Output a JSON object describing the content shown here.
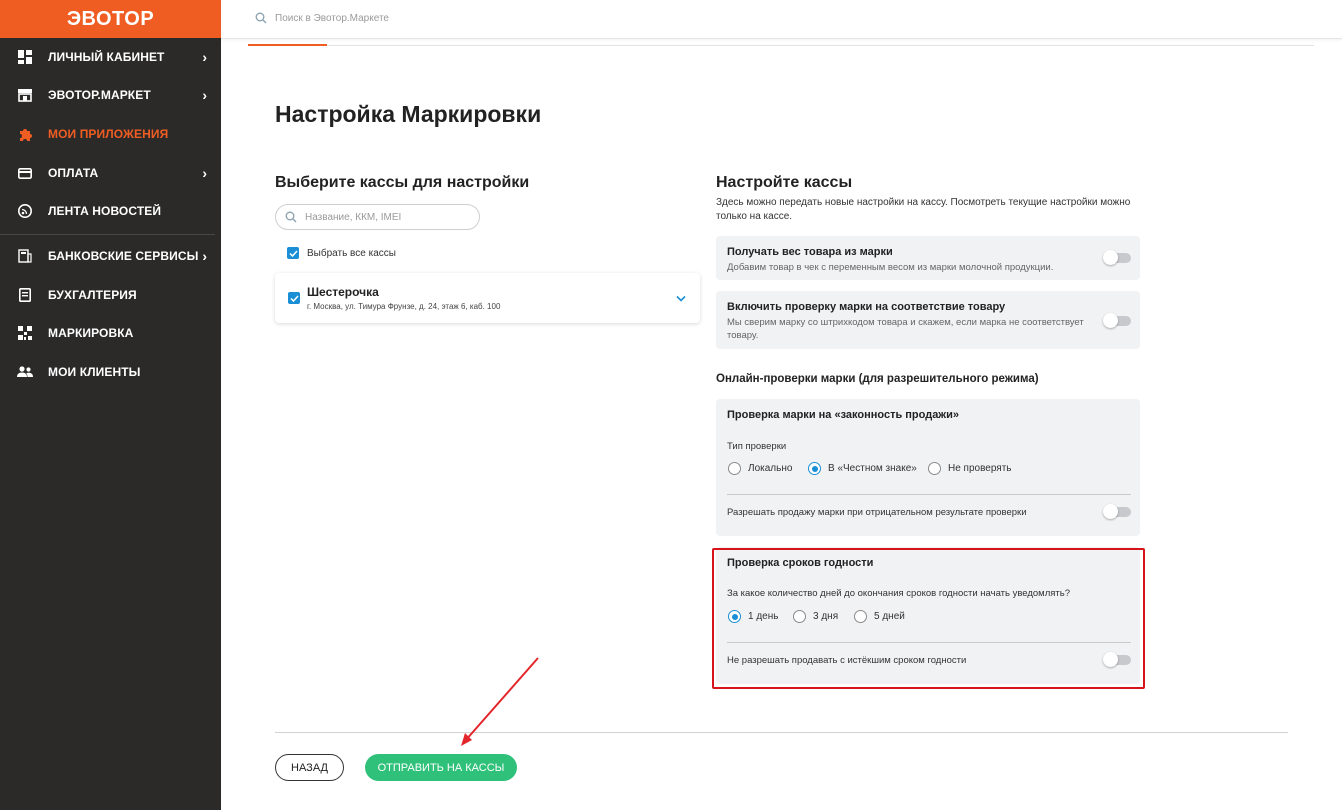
{
  "brand": {
    "logo": "ЭВОТОР",
    "accent": "#f05d22",
    "sidebar_bg": "#2b2a29",
    "link_blue": "#1a8fd6",
    "button_green": "#2fc17a",
    "highlight_red": "#d6141a"
  },
  "topbar": {
    "search_placeholder": "Поиск в Эвотор.Маркете"
  },
  "sidebar": {
    "items": [
      {
        "label": "ЛИЧНЫЙ КАБИНЕТ",
        "icon": "dashboard-icon",
        "chevron": "›"
      },
      {
        "label": "ЭВОТОР.МАРКЕТ",
        "icon": "store-icon",
        "chevron": "›"
      },
      {
        "label": "МОИ ПРИЛОЖЕНИЯ",
        "icon": "puzzle-icon",
        "active": true
      },
      {
        "label": "ОПЛАТА",
        "icon": "card-icon",
        "chevron": "›"
      },
      {
        "label": "ЛЕНТА НОВОСТЕЙ",
        "icon": "news-icon"
      },
      {
        "label": "БАНКОВСКИЕ СЕРВИСЫ",
        "icon": "bank-icon",
        "chevron": "›"
      },
      {
        "label": "БУХГАЛТЕРИЯ",
        "icon": "ledger-icon"
      },
      {
        "label": "МАРКИРОВКА",
        "icon": "qr-icon"
      },
      {
        "label": "МОИ КЛИЕНТЫ",
        "icon": "users-icon"
      }
    ]
  },
  "page": {
    "title": "Настройка Маркировки"
  },
  "left": {
    "title": "Выберите кассы для настройки",
    "search_placeholder": "Название, ККМ, IMEI",
    "select_all": "Выбрать все кассы",
    "kassa": {
      "name": "Шестерочка",
      "address": "г. Москва, ул. Тимура Фрунзе, д. 24, этаж 6, каб. 100"
    }
  },
  "right": {
    "title": "Настройте кассы",
    "description": "Здесь можно передать новые настройки на кассу. Посмотреть текущие настройки можно только на кассе.",
    "weight": {
      "title": "Получать вес товара из марки",
      "sub": "Добавим товар в чек с переменным весом из марки молочной продукции."
    },
    "match": {
      "title": "Включить проверку марки на соответствие товару",
      "sub": "Мы сверим марку со штрихкодом товара и скажем, если марка не соответствует товару."
    },
    "online_heading": "Онлайн-проверки марки (для разрешительного режима)",
    "legality": {
      "title": "Проверка марки на «законность продажи»",
      "type_label": "Тип проверки",
      "options": [
        "Локально",
        "В «Честном знаке»",
        "Не проверять"
      ],
      "selected_index": 1,
      "allow_label": "Разрешать продажу марки при отрицательном результате проверки"
    },
    "expiry": {
      "title": "Проверка сроков годности",
      "question": "За какое количество дней до окончания сроков годности начать уведомлять?",
      "options": [
        "1 день",
        "3 дня",
        "5 дней"
      ],
      "selected_index": 0,
      "forbid_label": "Не разрешать продавать с истёкшим сроком годности"
    }
  },
  "footer": {
    "back": "НАЗАД",
    "send": "ОТПРАВИТЬ НА КАССЫ"
  }
}
